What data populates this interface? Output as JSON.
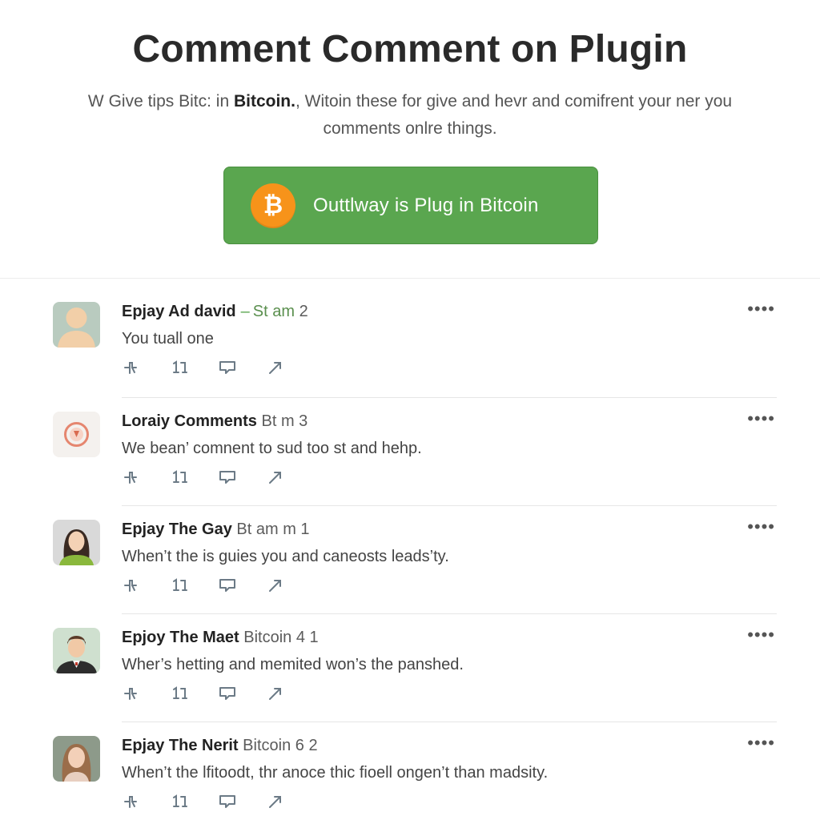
{
  "header": {
    "title": "Comment Comment on Plugin",
    "subtitle_pre": "W Give tips Bitc: in ",
    "subtitle_bold": "Bitcoin.",
    "subtitle_post": ", Witoin these for give and hevr and comifrent your ner you comments onlre things."
  },
  "cta": {
    "label": "Outtlway is Plug in Bitcoin",
    "coin_symbol": "₿",
    "color": "#5aa64f",
    "coin_color": "#f7931a"
  },
  "comments": [
    {
      "author": "Epjay Ad david",
      "sep": "–",
      "meta_green": "St am",
      "meta": "2",
      "body": "You tuall one",
      "more": "••••",
      "avatar": "person-placeholder-icon"
    },
    {
      "author": "Loraiy Comments",
      "sep": "",
      "meta_green": "",
      "meta": "Bt m 3",
      "body": "We bean’ comnent to sud too st and hehp.",
      "more": "••••",
      "avatar": "ring-logo-icon"
    },
    {
      "author": "Epjay The Gay",
      "sep": "",
      "meta_green": "",
      "meta": "Bt am m 1",
      "body": "When’t the is guies you and caneosts leads’ty.",
      "more": "••••",
      "avatar": "woman-avatar"
    },
    {
      "author": "Epjoy The Maet",
      "sep": "",
      "meta_green": "",
      "meta": "Bitcoin 4 1",
      "body": "Wher’s hetting and memited won’s the panshed.",
      "more": "••••",
      "avatar": "man-avatar"
    },
    {
      "author": "Epjay The Nerit",
      "sep": "",
      "meta_green": "",
      "meta": "Bitcoin 6 2",
      "body": "When’t the lfitoodt, thr anoce thic fioell ongen’t than madsity.",
      "more": "••••",
      "avatar": "woman-photo-avatar"
    }
  ]
}
